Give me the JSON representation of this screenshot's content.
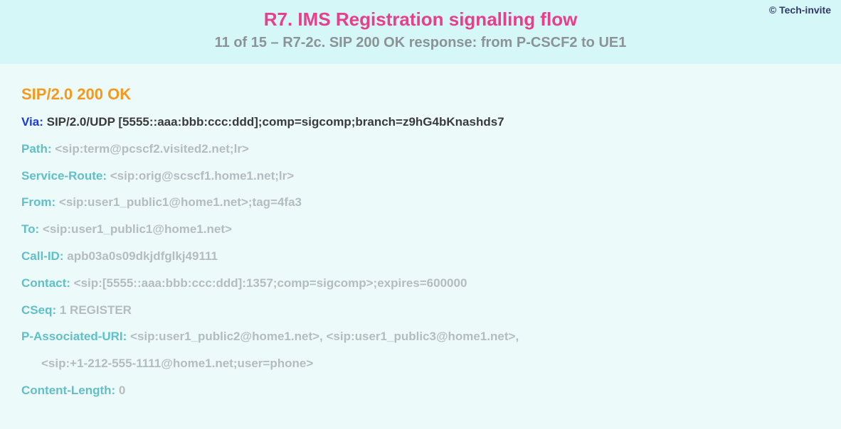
{
  "header": {
    "copyright": "© Tech-invite",
    "title": "R7. IMS Registration signalling flow",
    "subtitle": "11 of 15 – R7-2c. SIP 200 OK response: from P-CSCF2 to UE1"
  },
  "sip": {
    "status_line": "SIP/2.0 200 OK",
    "via": {
      "name": "Via",
      "value": "SIP/2.0/UDP [5555::aaa:bbb:ccc:ddd];comp=sigcomp;branch=z9hG4bKnashds7"
    },
    "path": {
      "name": "Path",
      "value": "<sip:term@pcscf2.visited2.net;lr>"
    },
    "service_route": {
      "name": "Service-Route",
      "value": "<sip:orig@scscf1.home1.net;lr>"
    },
    "from": {
      "name": "From",
      "value": "<sip:user1_public1@home1.net>;tag=4fa3"
    },
    "to": {
      "name": "To",
      "value": "<sip:user1_public1@home1.net>"
    },
    "call_id": {
      "name": "Call-ID",
      "value": "apb03a0s09dkjdfglkj49111"
    },
    "contact": {
      "name": "Contact",
      "value": "<sip:[5555::aaa:bbb:ccc:ddd]:1357;comp=sigcomp>;expires=600000"
    },
    "cseq": {
      "name": "CSeq",
      "value": "1 REGISTER"
    },
    "p_associated_uri": {
      "name": "P-Associated-URI",
      "value_line1": "<sip:user1_public2@home1.net>, <sip:user1_public3@home1.net>,",
      "value_line2": "<sip:+1-212-555-1111@home1.net;user=phone>"
    },
    "content_length": {
      "name": "Content-Length",
      "value": "0"
    }
  }
}
